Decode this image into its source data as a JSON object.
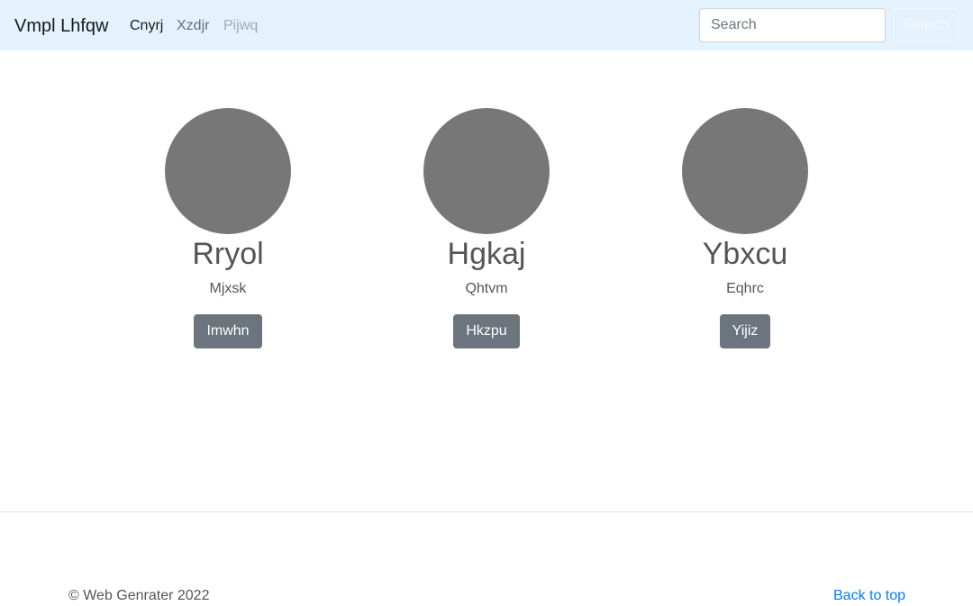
{
  "navbar": {
    "brand": "Vmpl Lhfqw",
    "links": [
      {
        "label": "Cnyrj",
        "state": "active"
      },
      {
        "label": "Xzdjr",
        "state": "normal"
      },
      {
        "label": "Pijwq",
        "state": "disabled"
      }
    ],
    "search": {
      "placeholder": "Search",
      "value": ""
    },
    "search_button": "Search"
  },
  "cards": [
    {
      "name": "Rryol",
      "subtitle": "Mjxsk",
      "button": "Imwhn"
    },
    {
      "name": "Hgkaj",
      "subtitle": "Qhtvm",
      "button": "Hkzpu"
    },
    {
      "name": "Ybxcu",
      "subtitle": "Eqhrc",
      "button": "Yijiz"
    }
  ],
  "footer": {
    "copyright": "© Web Genrater 2022",
    "back_to_top": "Back to top"
  },
  "colors": {
    "navbar_bg": "#e3f2fd",
    "avatar_fill": "#777777",
    "button_bg": "#6c757d",
    "link": "#007bff"
  }
}
